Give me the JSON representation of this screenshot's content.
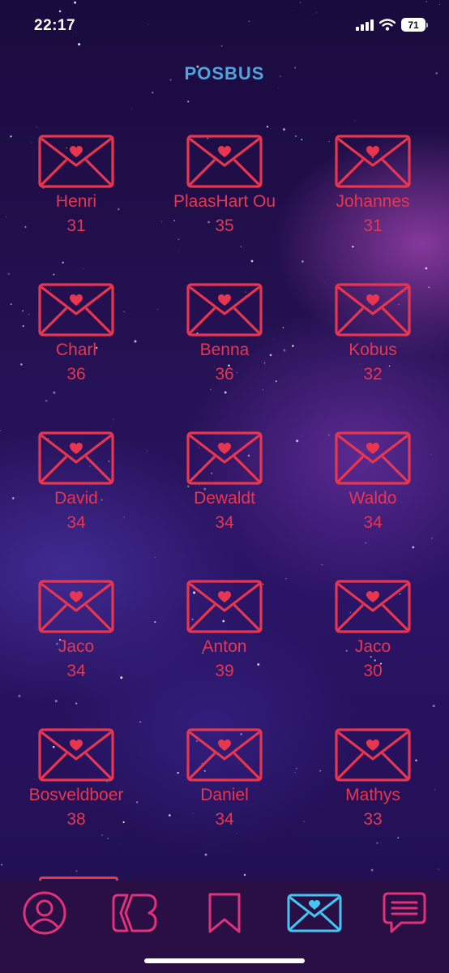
{
  "status_bar": {
    "time": "22:17",
    "battery": "71"
  },
  "page": {
    "title": "POSBUS"
  },
  "inbox": [
    {
      "name": "Henri",
      "age": "31"
    },
    {
      "name": "PlaasHart Ou",
      "age": "35"
    },
    {
      "name": "Johannes",
      "age": "31"
    },
    {
      "name": "Charl",
      "age": "36"
    },
    {
      "name": "Benna",
      "age": "36"
    },
    {
      "name": "Kobus",
      "age": "32"
    },
    {
      "name": "David",
      "age": "34"
    },
    {
      "name": "Dewaldt",
      "age": "34"
    },
    {
      "name": "Waldo",
      "age": "34"
    },
    {
      "name": "Jaco",
      "age": "34"
    },
    {
      "name": "Anton",
      "age": "39"
    },
    {
      "name": "Jaco",
      "age": "30"
    },
    {
      "name": "Bosveldboer",
      "age": "38"
    },
    {
      "name": "Daniel",
      "age": "34"
    },
    {
      "name": "Mathys",
      "age": "33"
    }
  ],
  "tab_bar": {
    "tabs": [
      {
        "icon": "profile-icon",
        "active": false
      },
      {
        "icon": "brand-logo-icon",
        "active": false
      },
      {
        "icon": "bookmark-icon",
        "active": false
      },
      {
        "icon": "mail-heart-icon",
        "active": true
      },
      {
        "icon": "chat-icon",
        "active": false
      }
    ]
  },
  "colors": {
    "accent": "#e7364f",
    "title": "#4fa4dc",
    "active_tab": "#45c6f2",
    "inactive_tab": "#e0327a"
  }
}
